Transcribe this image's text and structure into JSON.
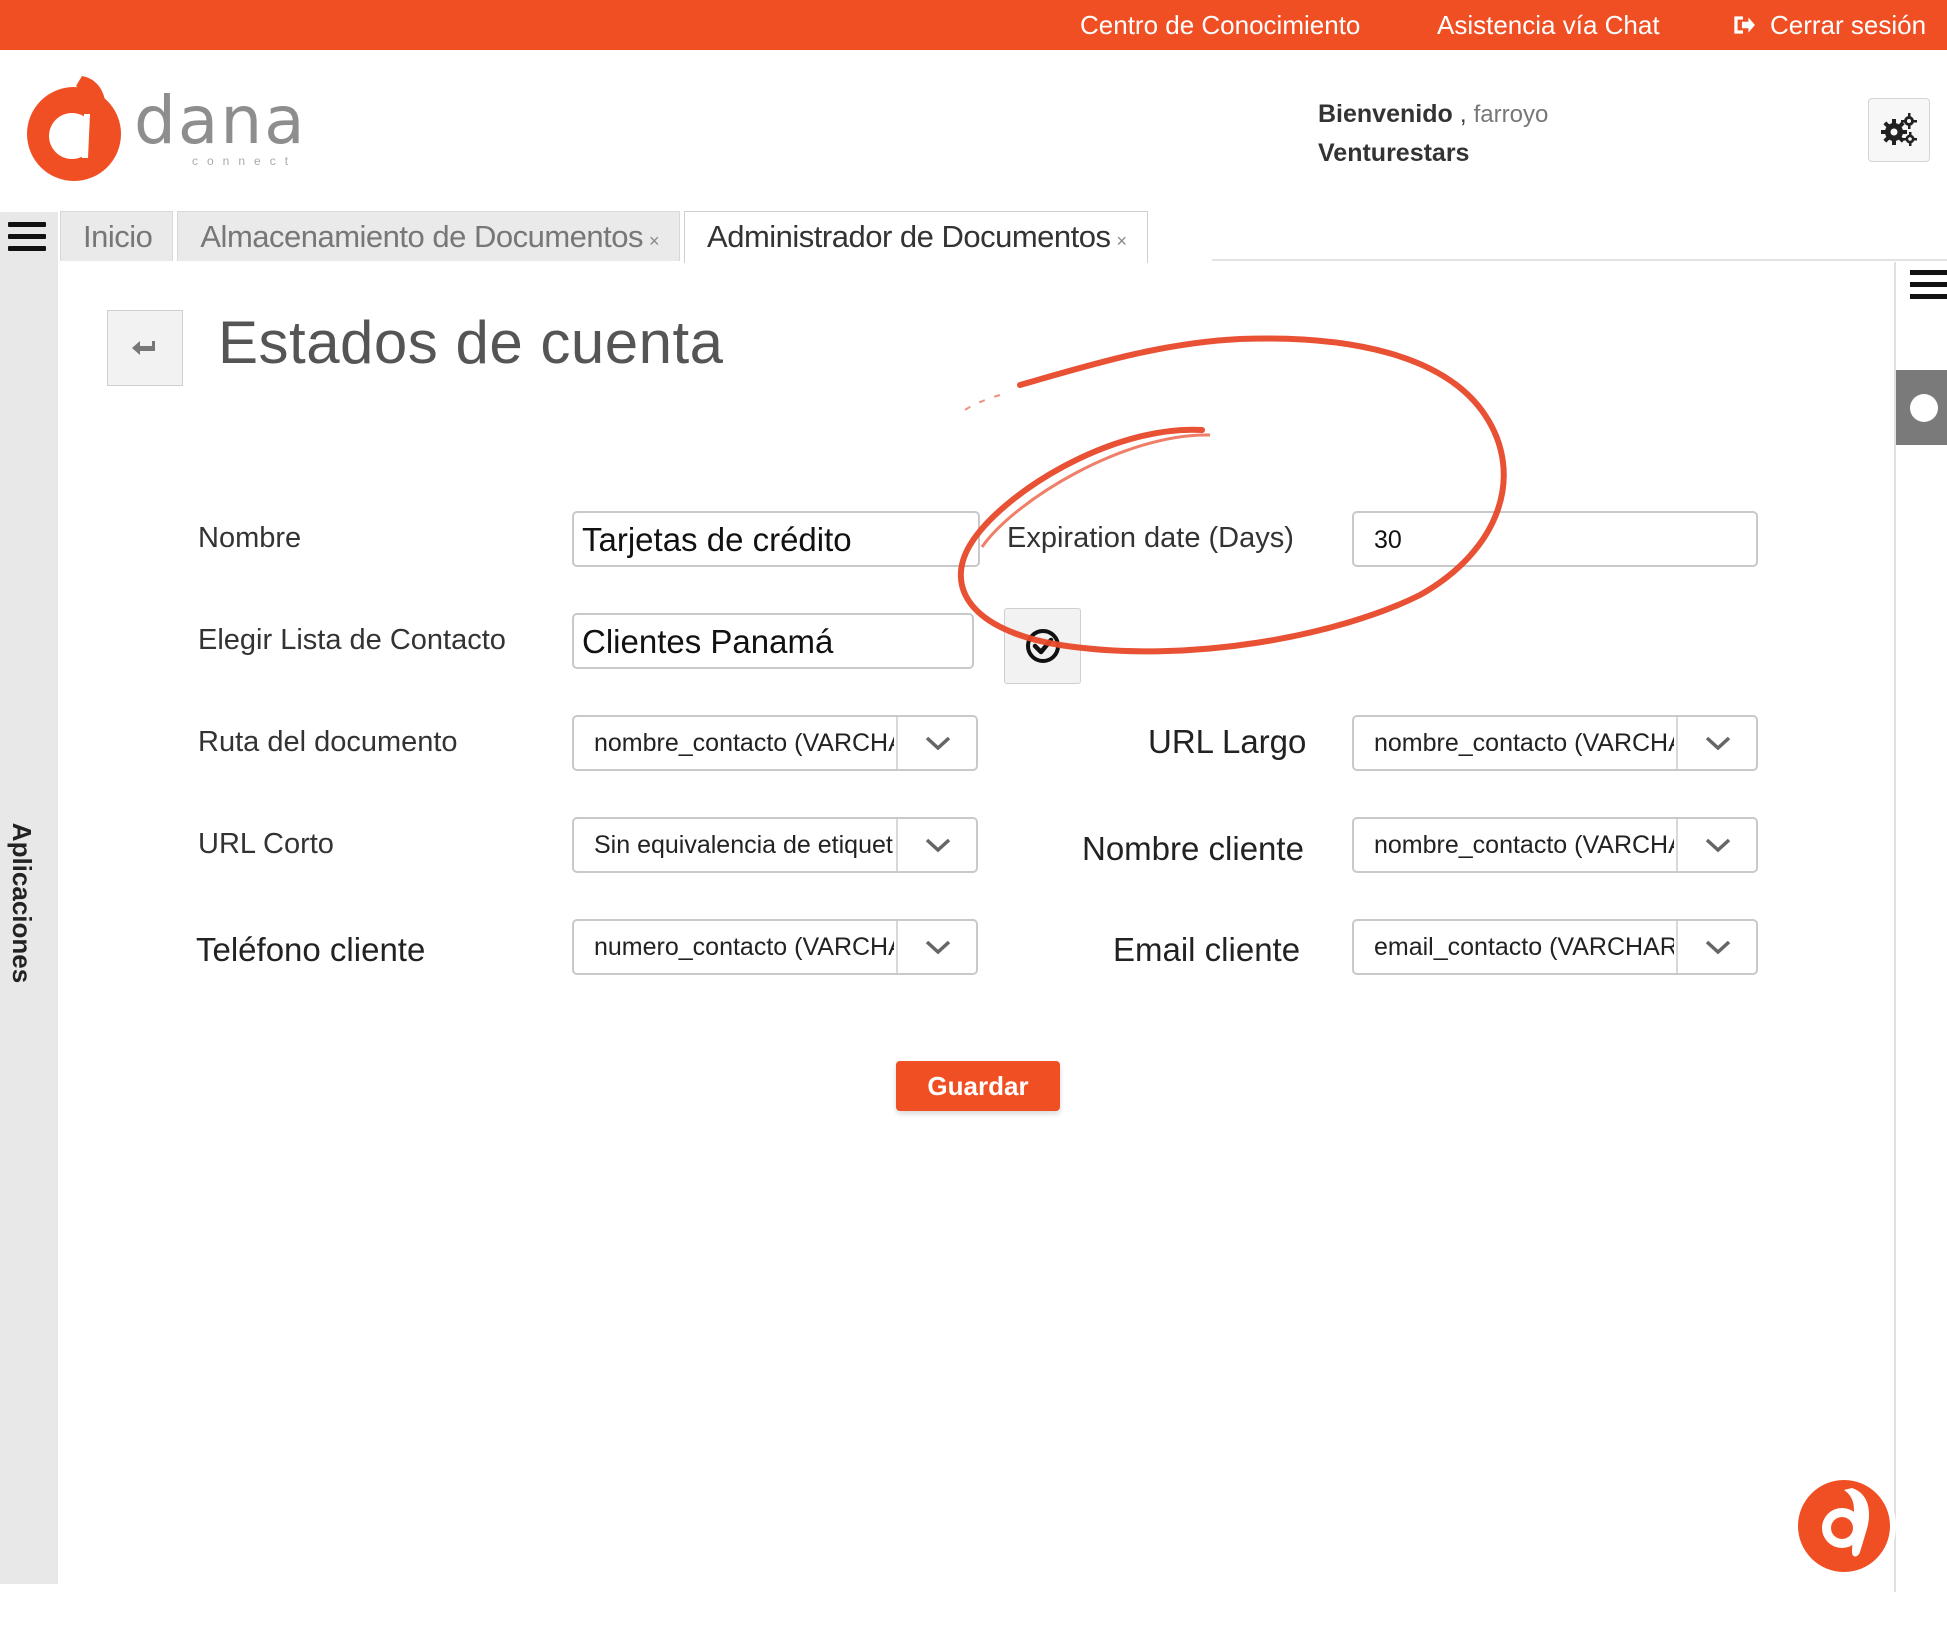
{
  "topbar": {
    "knowledge_center": "Centro de Conocimiento",
    "chat_support": "Asistencia vía Chat",
    "logout": "Cerrar sesión"
  },
  "brand": {
    "name": "dana",
    "tagline": "connect",
    "accent_color": "#f04e23"
  },
  "header": {
    "welcome": "Bienvenido",
    "separator": " , ",
    "username": "farroyo",
    "company": "Venturestars",
    "settings_icon": "gears-icon"
  },
  "sidebar": {
    "label": "Aplicaciones"
  },
  "tabs": [
    {
      "label": "Inicio",
      "closable": false
    },
    {
      "label": "Almacenamiento de Documentos",
      "closable": true,
      "close": "×"
    },
    {
      "label": "Administrador de Documentos",
      "closable": true,
      "close": "×",
      "active": true
    }
  ],
  "page": {
    "title": "Estados de cuenta"
  },
  "form": {
    "nombre": {
      "label": "Nombre",
      "value": "Tarjetas de crédito"
    },
    "expiration": {
      "label": "Expiration date (Days)",
      "value": "30"
    },
    "contact_list": {
      "label": "Elegir Lista de Contacto",
      "value": "Clientes Panamá"
    },
    "ruta": {
      "label": "Ruta del documento",
      "value": "nombre_contacto (VARCHAR)"
    },
    "url_largo": {
      "label": "URL Largo",
      "value": "nombre_contacto (VARCHAR)"
    },
    "url_corto": {
      "label": "URL Corto",
      "value": "Sin equivalencia de etiqueta"
    },
    "nombre_cliente": {
      "label": "Nombre cliente",
      "value": "nombre_contacto (VARCHAR)"
    },
    "telefono": {
      "label": "Teléfono cliente",
      "value": "numero_contacto (VARCHAR)"
    },
    "email": {
      "label": "Email cliente",
      "value": "email_contacto (VARCHAR)"
    },
    "save": "Guardar"
  },
  "annotation": {
    "color": "#e8482a"
  }
}
